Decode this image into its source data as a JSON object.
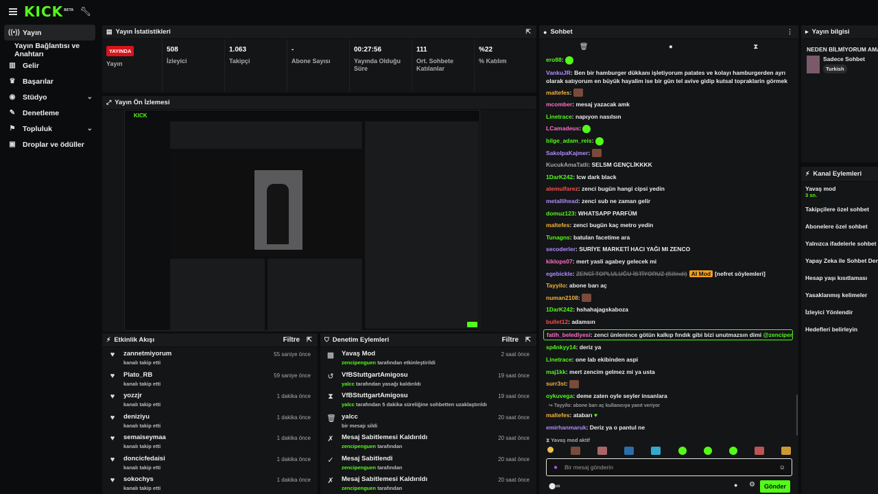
{
  "topbar": {
    "logo": "KICK",
    "beta": "BETA"
  },
  "sidebar": {
    "items": [
      {
        "label": "Yayın",
        "icon": "broadcast-icon",
        "active": true
      },
      {
        "label": "Yayın Bağlantısı ve Anahtarı",
        "sub": true
      },
      {
        "label": "Gelir",
        "icon": "chart-icon"
      },
      {
        "label": "Başarılar",
        "icon": "trophy-icon"
      },
      {
        "label": "Stüdyo",
        "icon": "palette-icon",
        "chev": true
      },
      {
        "label": "Denetleme",
        "icon": "wrench-icon"
      },
      {
        "label": "Topluluk",
        "icon": "community-icon",
        "chev": true
      },
      {
        "label": "Droplar ve ödüller",
        "icon": "gift-icon"
      }
    ]
  },
  "stats": {
    "title": "Yayın İstatistikleri",
    "items": [
      {
        "value": "YAYINDA",
        "label": "Yayın",
        "live": true
      },
      {
        "value": "508",
        "label": "İzleyici"
      },
      {
        "value": "1.063",
        "label": "Takipçi"
      },
      {
        "value": "-",
        "label": "Abone Sayısı"
      },
      {
        "value": "00:27:56",
        "label": "Yayında Olduğu Süre"
      },
      {
        "value": "111",
        "label": "Ort. Sohbete Katılanlar"
      },
      {
        "value": "%22",
        "label": "% Katılım"
      }
    ]
  },
  "preview": {
    "title": "Yayın Ön İzlemesi"
  },
  "activity": {
    "title": "Etkinlik Akışı",
    "filter": "Filtre",
    "rows": [
      {
        "name": "zannetmiyorum",
        "sub": "kanalı takip etti",
        "time": "55 saniye önce"
      },
      {
        "name": "Plato_RB",
        "sub": "kanalı takip etti",
        "time": "59 saniye önce"
      },
      {
        "name": "yozzjr",
        "sub": "kanalı takip etti",
        "time": "1 dakika önce"
      },
      {
        "name": "deniziyu",
        "sub": "kanalı takip etti",
        "time": "1 dakika önce"
      },
      {
        "name": "semaiseymaa",
        "sub": "kanalı takip etti",
        "time": "1 dakika önce"
      },
      {
        "name": "doncicfedaisi",
        "sub": "kanalı takip etti",
        "time": "1 dakika önce"
      },
      {
        "name": "sokochys",
        "sub": "kanalı takip etti",
        "time": "1 dakika önce"
      }
    ]
  },
  "moderation": {
    "title": "Denetim Eylemleri",
    "filter": "Filtre",
    "rows": [
      {
        "icon": "chat-icon",
        "name": "Yavaş Mod",
        "who": "zencipenguen",
        "rest": " tarafından etkinleştirildi",
        "time": "2 saat önce"
      },
      {
        "icon": "undo-icon",
        "name": "VfBStuttgartAmigosu",
        "who": "yalcc",
        "rest": " tarafından yasağı kaldırıldı",
        "time": "19 saat önce"
      },
      {
        "icon": "hourglass-icon",
        "name": "VfBStuttgartAmigosu",
        "who": "yalcc",
        "rest": " tarafından 5 dakika süreliğine sohbetten uzaklaştırıldı",
        "time": "19 saat önce"
      },
      {
        "icon": "trash-icon",
        "name": "yalcc",
        "who": "",
        "rest": "bir mesajı sildi",
        "time": "20 saat önce"
      },
      {
        "icon": "unpin-icon",
        "name": "Mesaj Sabitlemesi Kaldırıldı",
        "who": "zencipenguen",
        "rest": " tarafından",
        "time": "20 saat önce"
      },
      {
        "icon": "pin-icon",
        "name": "Mesaj Sabitlendi",
        "who": "zencipenguen",
        "rest": " tarafından",
        "time": "20 saat önce"
      },
      {
        "icon": "unpin-icon",
        "name": "Mesaj Sabitlemesi Kaldırıldı",
        "who": "zencipenguen",
        "rest": " tarafından",
        "time": "20 saat önce"
      }
    ]
  },
  "chat": {
    "title": "Sohbet",
    "messages": [
      {
        "user": "ero88",
        "color": "#53fc18",
        "text": "",
        "emote": "g"
      },
      {
        "user": "VankuJR",
        "color": "#b08cff",
        "text": "Ben bir hamburger dükkanı işletiyorum patates ve kolayı hamburgerden ayrı olarak satıyorum en büyük hayalim ise bir gün tel avive gidip kutsal topraklarin görmek",
        "wrap": true
      },
      {
        "user": "maltefes",
        "color": "#f4b43c",
        "text": "",
        "emote": "img"
      },
      {
        "user": "mcomber",
        "color": "#ff6ec7",
        "text": "mesaj yazacak amk"
      },
      {
        "user": "Linetrace",
        "color": "#53fc18",
        "text": "napıyon nasılsın"
      },
      {
        "user": "LCamadeus",
        "color": "#ff6ec7",
        "text": "",
        "emote": "g"
      },
      {
        "user": "bilge_adam_reis",
        "color": "#53fc18",
        "text": "",
        "emote": "g"
      },
      {
        "user": "SakolpaKajmer",
        "color": "#b08cff",
        "text": "",
        "emote": "img"
      },
      {
        "user": "KucukAmaTatli",
        "color": "#aaaaaa",
        "text": "SELSM GENÇLİKKKK"
      },
      {
        "user": "1DarK242",
        "color": "#53fc18",
        "text": "lcw dark black"
      },
      {
        "user": "alemulfarez",
        "color": "#ff4d4d",
        "text": "zenci bugün hangi cipsi yedin"
      },
      {
        "user": "metallihead",
        "color": "#b08cff",
        "text": "zenci sub ne zaman gelir"
      },
      {
        "user": "domuz123",
        "color": "#53fc18",
        "text": "WHATSAPP PARFÜM"
      },
      {
        "user": "maltefes",
        "color": "#f4b43c",
        "text": "zenci bugün kaç metro yedin"
      },
      {
        "user": "Tunagns",
        "color": "#53fc18",
        "text": "batulan facetime ara"
      },
      {
        "user": "secoderler",
        "color": "#b08cff",
        "text": "SURİYE MARKETİ HACI YAĞI MI ZENCO"
      },
      {
        "user": "kiklops07",
        "color": "#ff6ec7",
        "text": "mert yasli agabey gelecek mi"
      },
      {
        "user": "egebickle",
        "color": "#b08cff",
        "text": "ZENCİ TOPLULUĞU İSTİYORUZ (Silindi)",
        "mod": "AI Mod",
        "tail": "[nefret söylemleri]"
      },
      {
        "user": "Tayyilo",
        "color": "#f4b43c",
        "text": "abone barı aç"
      },
      {
        "user": "numan2108",
        "color": "#f4b43c",
        "text": "",
        "emote": "img"
      },
      {
        "user": "1DarK242",
        "color": "#53fc18",
        "text": "hshahajagskaboza"
      },
      {
        "user": "bullet12",
        "color": "#ff4d4d",
        "text": "adamsın"
      },
      {
        "user": "fatih_beledlyesi",
        "color": "#ff6ec7",
        "text": "zenci ünlenince götün kalkıp fındık gibi bizi unutmazsın dimi ",
        "mention": "@zencipenguen",
        "highlight": true
      },
      {
        "user": "sp4nkyy14",
        "color": "#53fc18",
        "text": "deriz ya"
      },
      {
        "user": "Linetrace",
        "color": "#53fc18",
        "text": "one lab ekibinden aspi"
      },
      {
        "user": "maj1kk",
        "color": "#53fc18",
        "text": "mert zencim gelmez mi ya usta"
      },
      {
        "user": "surr3st",
        "color": "#f4b43c",
        "text": "",
        "emote": "img"
      },
      {
        "user": "oykuvega",
        "color": "#53fc18",
        "text": "deme zaten oyle seyler insanlara"
      }
    ],
    "reply_to": "↪ Tayyilo: abone barı aç kullanıcıya yanıt veriyor",
    "tail": [
      {
        "user": "maltefes",
        "color": "#f4b43c",
        "text": "atabarı ",
        "heart": "♥"
      },
      {
        "user": "emirhanmaruk",
        "color": "#b08cff",
        "text": "Deriz ya o pantul ne"
      }
    ],
    "slow_mode": "Yavaş mod aktif",
    "placeholder": "Bir mesaj gönderin",
    "send": "Gönder"
  },
  "stream_info": {
    "title": "Yayın bilgisi",
    "stream_title": "NEDEN BİLMİYORUM AMA",
    "category": "Sadece Sohbet",
    "tag": "Turkish"
  },
  "channel_actions": {
    "title": "Kanal Eylemleri",
    "items": [
      {
        "label": "Yavaş mod",
        "sub": "3 sn."
      },
      {
        "label": "Takipçilere özel sohbet"
      },
      {
        "label": "Abonelere özel sohbet"
      },
      {
        "label": "Yalnızca ifadelerle sohbet"
      },
      {
        "label": "Yapay Zeka ile Sohbet Dene"
      },
      {
        "label": "Hesap yaşı kısıtlaması"
      },
      {
        "label": "Yasaklanmış kelimeler"
      },
      {
        "label": "İzleyici Yönlendir"
      },
      {
        "label": "Hedefleri belirleyin"
      }
    ]
  }
}
